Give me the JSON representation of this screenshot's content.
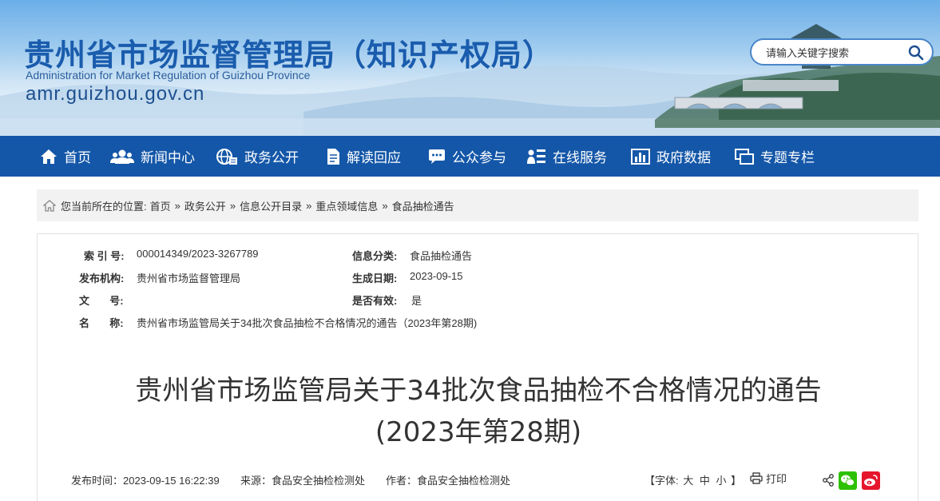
{
  "header": {
    "title": "贵州省市场监督管理局（知识产权局）",
    "subtitle_en": "Administration for Market Regulation of Guizhou Province",
    "url": "amr.guizhou.gov.cn",
    "search_placeholder": "请输入关键字搜索"
  },
  "nav": {
    "items": [
      {
        "label": "首页",
        "icon": "home-icon"
      },
      {
        "label": "新闻中心",
        "icon": "people-icon"
      },
      {
        "label": "政务公开",
        "icon": "globe-icon"
      },
      {
        "label": "解读回应",
        "icon": "document-icon"
      },
      {
        "label": "公众参与",
        "icon": "chat-icon"
      },
      {
        "label": "在线服务",
        "icon": "user-list-icon"
      },
      {
        "label": "政府数据",
        "icon": "bar-chart-icon"
      },
      {
        "label": "专题专栏",
        "icon": "windows-icon"
      }
    ]
  },
  "breadcrumb": {
    "prefix": "您当前所在的位置:",
    "items": [
      "首页",
      "政务公开",
      "信息公开目录",
      "重点领域信息",
      "食品抽检通告"
    ],
    "separator": "»"
  },
  "meta": {
    "index_label": "索 引 号:",
    "index_value": "000014349/2023-3267789",
    "category_label": "信息分类:",
    "category_value": "食品抽检通告",
    "publisher_label": "发布机构:",
    "publisher_value": "贵州省市场监督管理局",
    "date_label": "生成日期:",
    "date_value": "2023-09-15",
    "doc_no_label": "文       号:",
    "doc_no_value": "",
    "valid_label": "是否有效:",
    "valid_value": "是",
    "name_label": "名       称:",
    "name_value": "贵州省市场监管局关于34批次食品抽检不合格情况的通告（2023年第28期)"
  },
  "article": {
    "title_line1": "贵州省市场监管局关于34批次食品抽检不合格情况的通告",
    "title_line2": "(2023年第28期)",
    "publish_time": "发布时间：2023-09-15 16:22:39",
    "source": "来源：食品安全抽检检测处",
    "author": "作者：食品安全抽检检测处",
    "font_label_open": "【字体:",
    "font_large": "大",
    "font_medium": "中",
    "font_small": "小",
    "font_label_close": "】",
    "print_label": "打印"
  },
  "colors": {
    "nav_bg": "#1457a8",
    "title_blue": "#1a5cad",
    "wechat": "#2dc100",
    "weibo": "#e6162d"
  }
}
